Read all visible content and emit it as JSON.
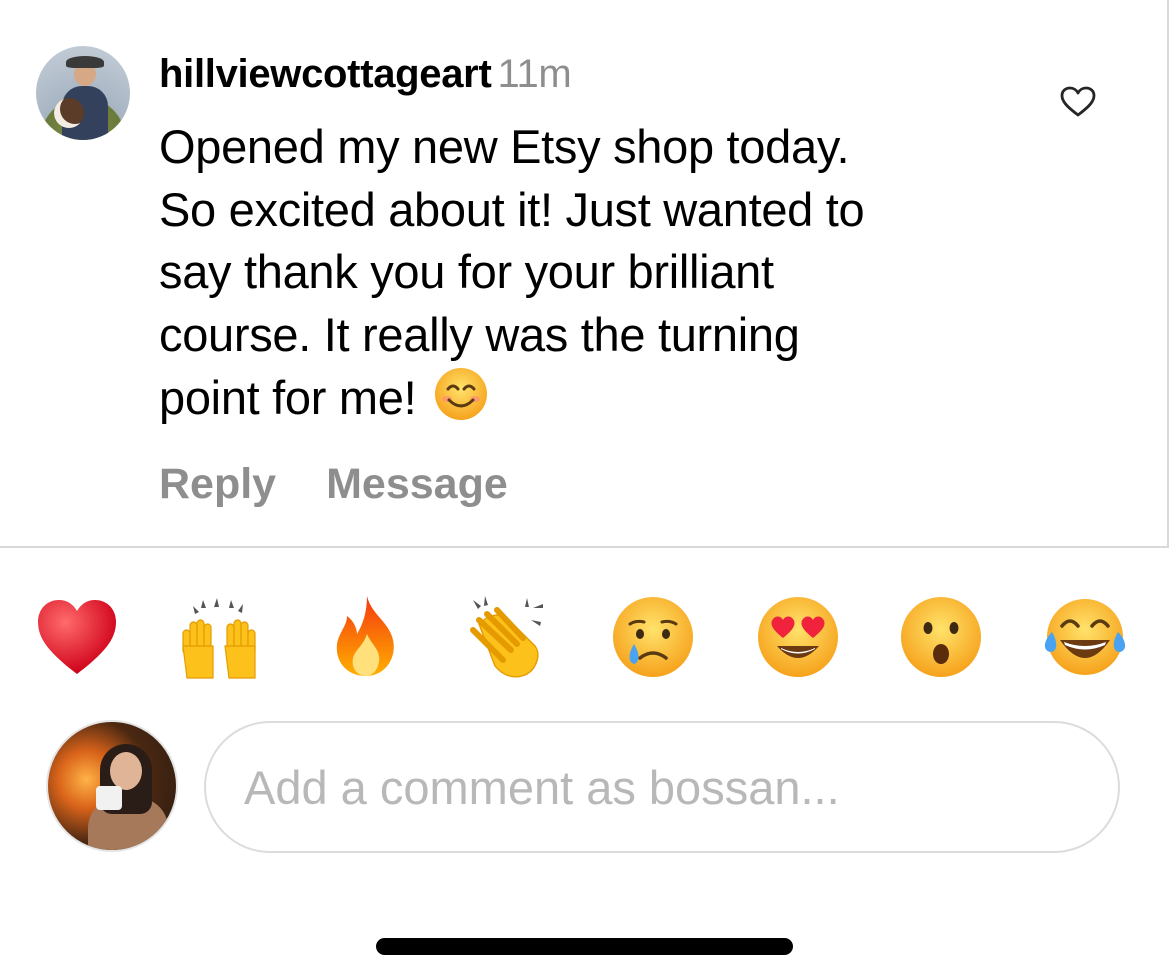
{
  "comment": {
    "username": "hillviewcottageart",
    "timestamp": "11m",
    "text": "Opened my new Etsy shop today.\nSo excited about it! Just wanted to\nsay thank you for your brilliant\ncourse. It really was the turning\npoint for me!",
    "trailing_emoji": "smiling-face-with-smiling-eyes",
    "actions": {
      "reply_label": "Reply",
      "message_label": "Message"
    },
    "like_icon": "heart-outline-icon"
  },
  "reactions": [
    {
      "name": "red-heart"
    },
    {
      "name": "raising-hands"
    },
    {
      "name": "fire"
    },
    {
      "name": "clapping-hands"
    },
    {
      "name": "crying-face"
    },
    {
      "name": "heart-eyes-face"
    },
    {
      "name": "surprised-face"
    },
    {
      "name": "tears-of-joy-face"
    }
  ],
  "composer": {
    "placeholder": "Add a comment as bossan..."
  },
  "colors": {
    "text": "#000000",
    "secondary_text": "#8e8e8e",
    "placeholder": "#b8b8b8",
    "divider": "#d9d9d9"
  }
}
